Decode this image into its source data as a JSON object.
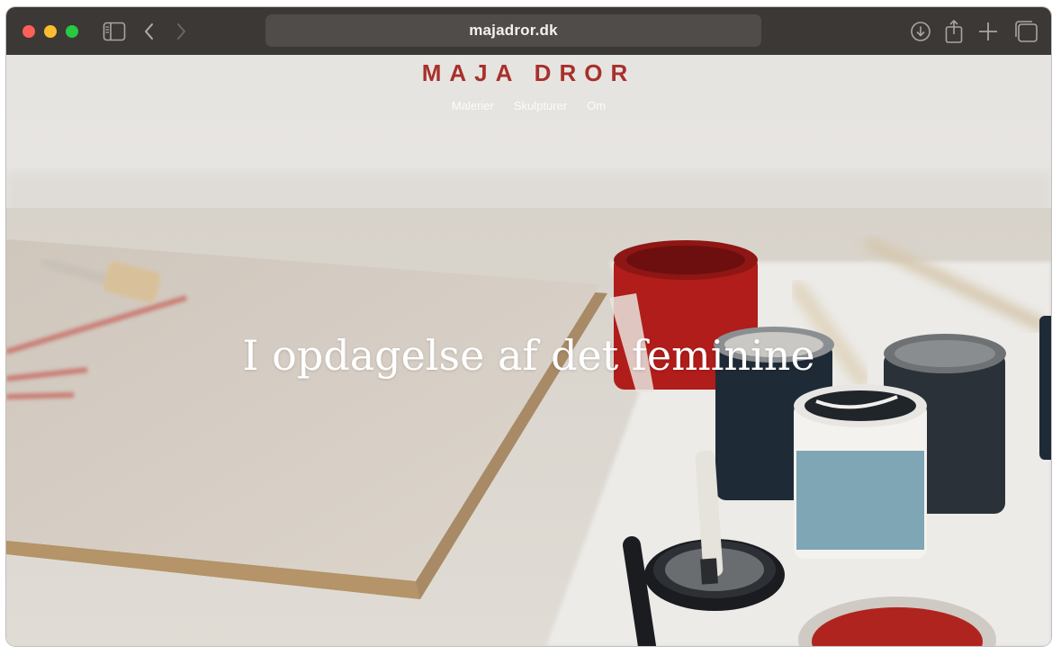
{
  "browser": {
    "address": "majadror.dk",
    "icons": {
      "sidebar": "sidebar-icon",
      "back": "chevron-left-icon",
      "forward": "chevron-right-icon",
      "download": "download-icon",
      "share": "share-icon",
      "new_tab": "plus-icon",
      "tabs": "tab-overview-icon"
    },
    "colors": {
      "toolbar": "#3b3836",
      "address_bar": "#504c49"
    }
  },
  "site": {
    "logo": "MAJA DROR",
    "nav": [
      "Malerier",
      "Skulpturer",
      "Om"
    ],
    "headline": "I opdagelse af det feminine",
    "colors": {
      "logo": "#a8302b"
    }
  }
}
